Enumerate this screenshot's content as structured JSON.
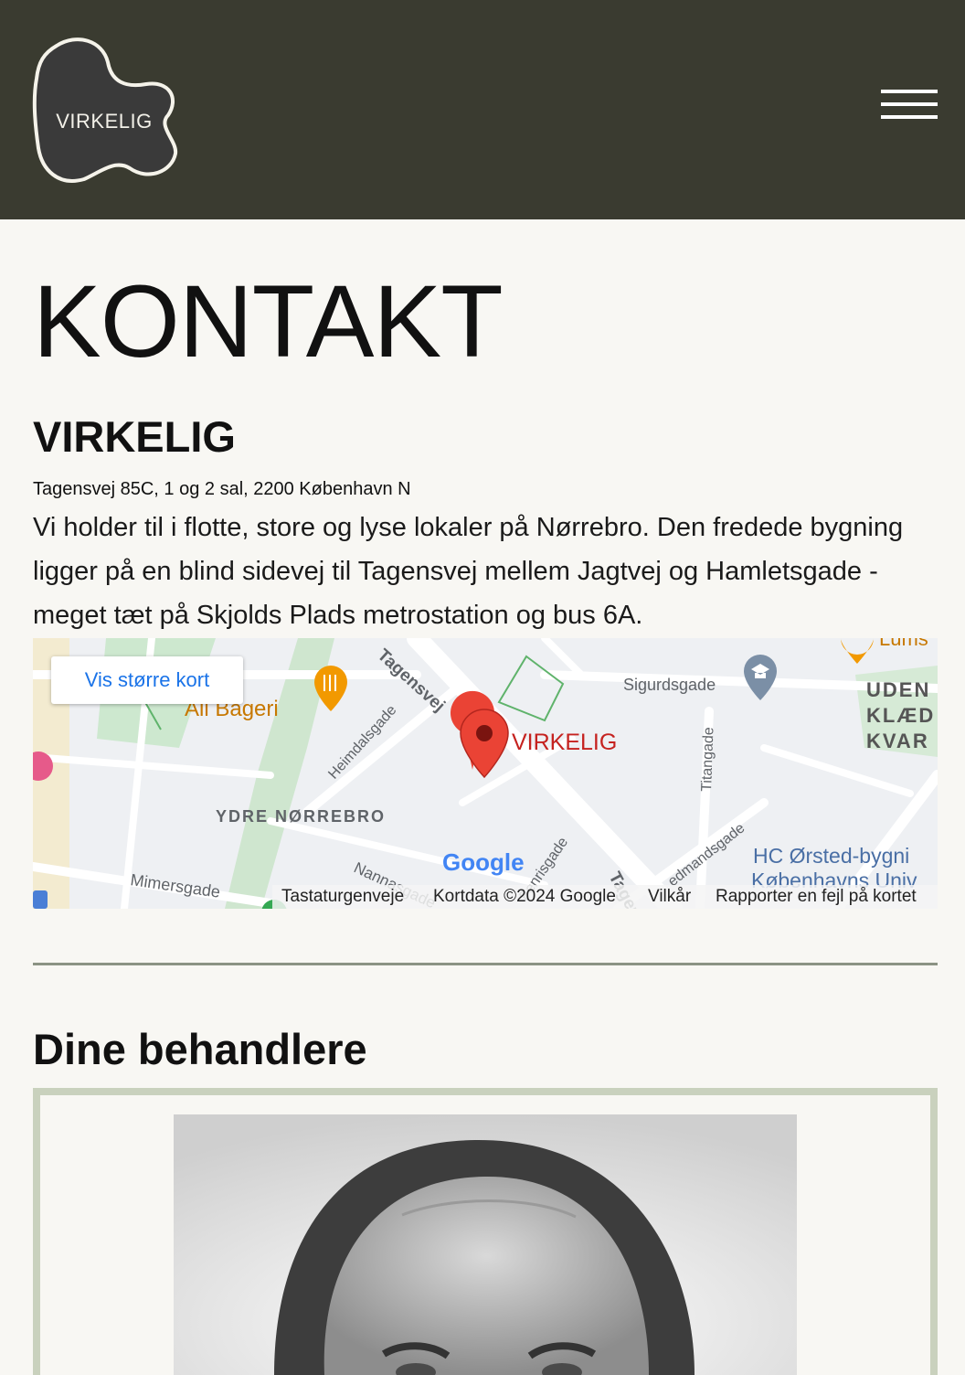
{
  "header": {
    "logo_text": "VIRKELIG"
  },
  "page": {
    "title": "KONTAKT",
    "brand": "VIRKELIG",
    "address": "Tagensvej 85C, 1 og 2 sal, 2200 København N",
    "description": "Vi holder til i flotte, store og lyse lokaler på Nørrebro. Den fredede bygning ligger på en blind sidevej til Tagensvej mellem Jagtvej og Hamletsgade - meget tæt på Skjolds Plads metrostation og bus 6A."
  },
  "map": {
    "larger_map_button": "Vis større kort",
    "marker_label": "VIRKELIG",
    "labels": {
      "street_tagensvej": "Tagensvej",
      "street_tagensvej_lower": "Tagens",
      "street_heimdalsgade": "Heimdalsgade",
      "street_sigurdsgade": "Sigurdsgade",
      "street_titangade": "Titangade",
      "district": "YDRE NØRREBRO",
      "street_mimersgade": "Mimersgade",
      "street_nannasgade": "Nannasgade",
      "street_fenrisgade": "Fenrisgade",
      "street_hedmandsgade": "edmandsgade",
      "place_bageri": "Ali Bageri",
      "place_hc_orsted_1": "HC Ørsted-bygni",
      "place_hc_orsted_2": "Københavns Univ",
      "area_1": "UDEN",
      "area_2": "KLÆD",
      "area_3": "KVAR",
      "top_partial": "Lums",
      "google": "Google"
    },
    "footer": {
      "shortcuts": "Tastaturgenveje",
      "mapdata": "Kortdata ©2024 Google",
      "terms": "Vilkår",
      "report": "Rapporter en fejl på kortet"
    }
  },
  "therapists": {
    "title": "Dine behandlere"
  },
  "colors": {
    "header_bg": "#3a3b30",
    "page_bg": "#f8f7f3",
    "card_border": "#c9d1bd",
    "marker": "#ea4335",
    "link_blue": "#1a73e8"
  }
}
